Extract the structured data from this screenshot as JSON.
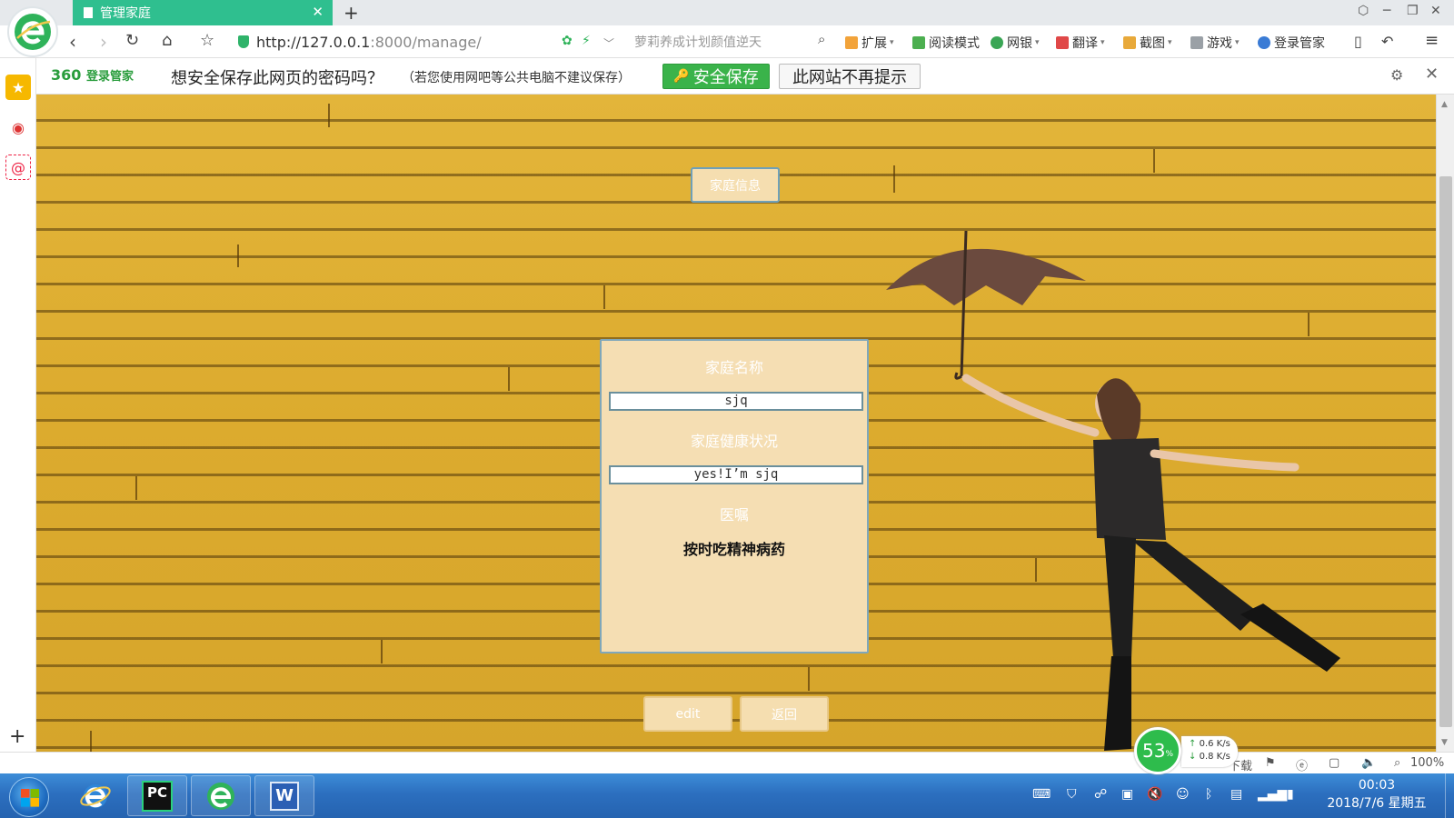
{
  "browser": {
    "tab_title": "管理家庭",
    "tab_close": "✕",
    "new_tab": "+",
    "url_host": "http://127.0.0.1",
    "url_rest": ":8000/manage/",
    "search_placeholder": "萝莉养成计划颜值逆天",
    "toolbar_items": {
      "extensions": "扩展",
      "reading_mode": "阅读模式",
      "netbank": "网银",
      "translate": "翻译",
      "screenshot": "截图",
      "games": "游戏",
      "login_manager": "登录管家"
    },
    "zoom": "100%",
    "download": "下载"
  },
  "password_bar": {
    "brand": "360",
    "brand_sub": "登录管家",
    "question": "想安全保存此网页的密码吗？",
    "note": "（若您使用网吧等公共电脑不建议保存）",
    "save_label": "安全保存",
    "never_label": "此网站不再提示"
  },
  "page": {
    "family_info_button": "家庭信息",
    "family_name_label": "家庭名称",
    "family_name_value": "sjq",
    "health_label": "家庭健康状况",
    "health_value": "yes!I’m sjq",
    "advice_label": "医嘱",
    "advice_text": "按时吃精神病药",
    "edit_button": "edit",
    "back_button": "返回"
  },
  "network": {
    "percent": "53",
    "percent_unit": "%",
    "up": "0.6 K/s",
    "down": "0.8 K/s"
  },
  "taskbar": {
    "time": "00:03",
    "date": "2018/7/6 星期五",
    "pycharm_label": "PC"
  },
  "colors": {
    "tab_active": "#2fbf8f",
    "save_green": "#3ab34a",
    "card_bg": "#f5deb3",
    "wall_yellow": "#e0b035"
  }
}
